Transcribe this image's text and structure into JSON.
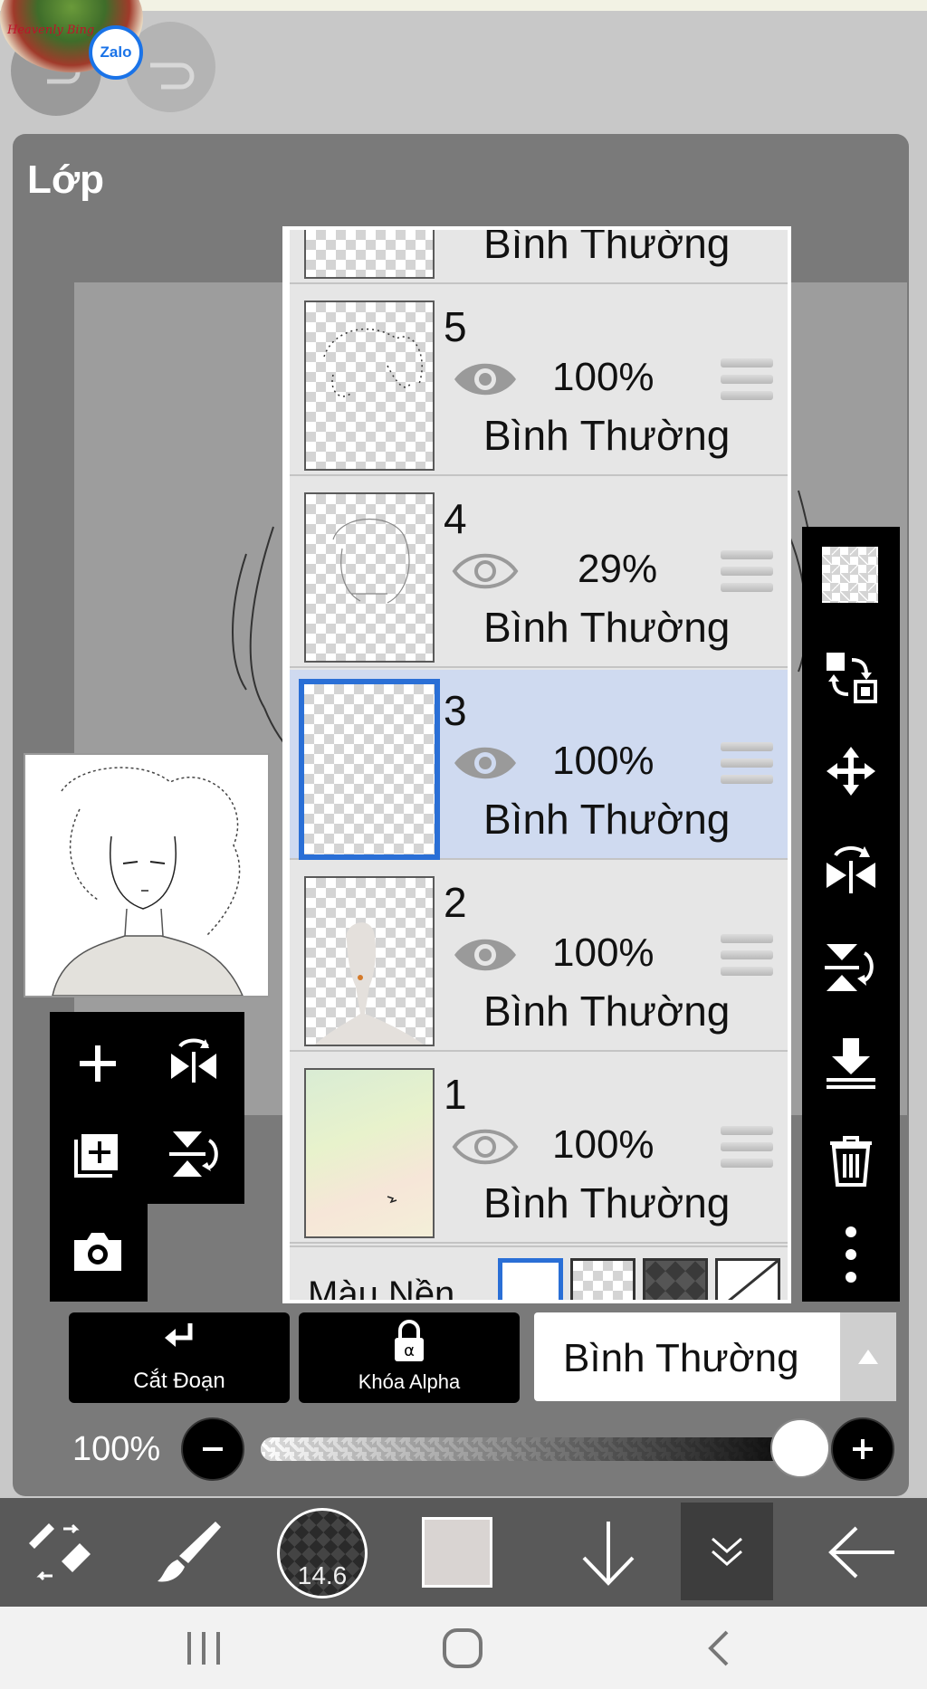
{
  "chat_head": {
    "avatar_text": "Heavenly Bing",
    "badge_label": "Zalo"
  },
  "panel": {
    "title": "Lớp"
  },
  "layers": [
    {
      "number": "",
      "opacity": "",
      "mode": "Bình Thường",
      "visible": true,
      "selected": false
    },
    {
      "number": "5",
      "opacity": "100%",
      "mode": "Bình Thường",
      "visible": true,
      "selected": false
    },
    {
      "number": "4",
      "opacity": "29%",
      "mode": "Bình Thường",
      "visible": false,
      "selected": false
    },
    {
      "number": "3",
      "opacity": "100%",
      "mode": "Bình Thường",
      "visible": true,
      "selected": true
    },
    {
      "number": "2",
      "opacity": "100%",
      "mode": "Bình Thường",
      "visible": true,
      "selected": false
    },
    {
      "number": "1",
      "opacity": "100%",
      "mode": "Bình Thường",
      "visible": false,
      "selected": false
    }
  ],
  "background_row": {
    "label": "Màu Nền"
  },
  "actions": {
    "clip_label": "Cắt Đoạn",
    "alpha_lock_label": "Khóa Alpha",
    "blend_mode": "Bình Thường"
  },
  "opacity": {
    "label": "100%",
    "value": 1.0
  },
  "toolbar": {
    "brush_size": "14.6",
    "color": "#d9d4d2"
  },
  "colors": {
    "selection": "#2a6fd6",
    "selected_row": "#cfdaf0",
    "panel": "#7a7a7a"
  }
}
